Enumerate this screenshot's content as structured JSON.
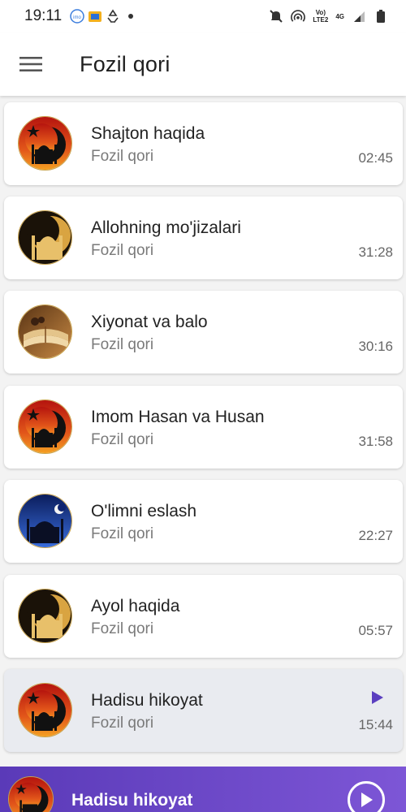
{
  "status_bar": {
    "time": "19:11",
    "left_icons": [
      "imo-icon",
      "tv-icon",
      "recycle-icon",
      "dot-icon"
    ],
    "net_line1": "Vo)",
    "net_line2": "LTE2",
    "net_type": "4G",
    "right_icons": [
      "mute-icon",
      "hotspot-icon",
      "signal-icon",
      "battery-icon"
    ]
  },
  "app_bar": {
    "menu_icon": "menu-icon",
    "title": "Fozil qori"
  },
  "tracks": [
    {
      "title": "Shajton haqida",
      "artist": "Fozil qori",
      "duration": "02:45",
      "art": "red-crescent"
    },
    {
      "title": "Allohning mo'jizalari",
      "artist": "Fozil qori",
      "duration": "31:28",
      "art": "gold-mosque"
    },
    {
      "title": "Xiyonat va balo",
      "artist": "Fozil qori",
      "duration": "30:16",
      "art": "book"
    },
    {
      "title": "Imom Hasan va Husan",
      "artist": "Fozil qori",
      "duration": "31:58",
      "art": "red-crescent"
    },
    {
      "title": "O'limni eslash",
      "artist": "Fozil qori",
      "duration": "22:27",
      "art": "blue-night"
    },
    {
      "title": "Ayol haqida",
      "artist": "Fozil qori",
      "duration": "05:57",
      "art": "gold-mosque"
    },
    {
      "title": "Hadisu hikoyat",
      "artist": "Fozil qori",
      "duration": "15:44",
      "art": "red-crescent",
      "playing": true
    }
  ],
  "player": {
    "title": "Hadisu hikoyat",
    "play_icon": "play-circle-icon"
  },
  "colors": {
    "accent": "#6a47c9",
    "active_card": "#e9ebf0",
    "indicator": "#5b3fc0"
  }
}
